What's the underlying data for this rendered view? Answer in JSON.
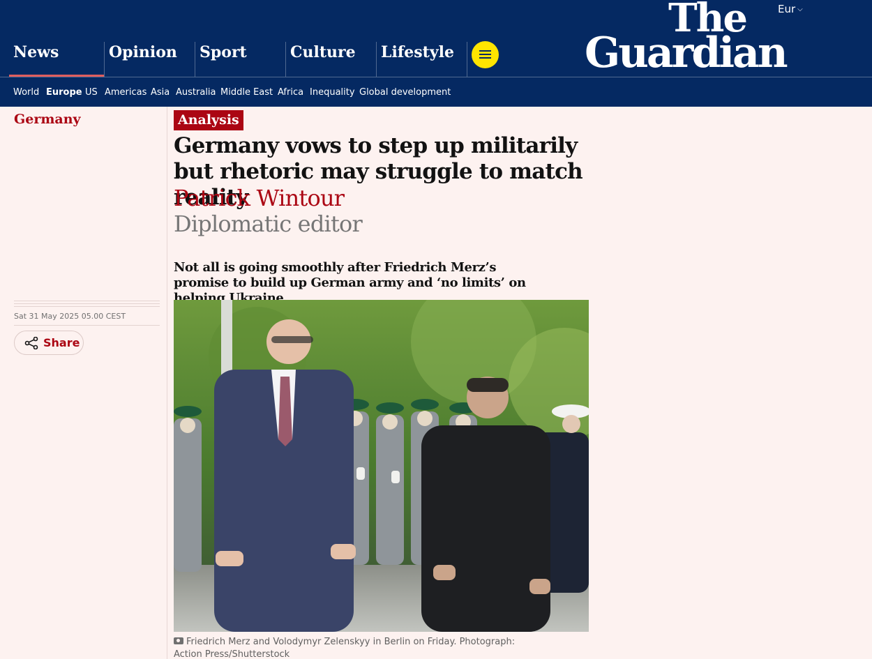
{
  "header": {
    "edition": "Eur",
    "logo_the": "The",
    "logo_guardian": "Guardian",
    "pillars": [
      "News",
      "Opinion",
      "Sport",
      "Culture",
      "Lifestyle"
    ],
    "active_pillar": "News"
  },
  "subnav": {
    "items": [
      "World",
      "Europe",
      "US",
      "Americas",
      "Asia",
      "Australia",
      "Middle East",
      "Africa",
      "Inequality",
      "Global development"
    ],
    "active": "Europe"
  },
  "sidebar": {
    "section": "Germany",
    "date": "Sat 31 May 2025 05.00 CEST",
    "share_label": "Share"
  },
  "article": {
    "kicker": "Analysis",
    "headline": "Germany vows to step up militarily but rhetoric may struggle to match reality",
    "byline": "Patrick Wintour",
    "role": "Diplomatic editor",
    "standfirst": "Not all is going smoothly after Friedrich Merz’s promise to build up German army and ‘no limits’ on helping Ukraine",
    "caption": "Friedrich Merz and Volodymyr Zelenskyy in Berlin on Friday. Photograph: Action Press/Shutterstock"
  },
  "colors": {
    "brand_blue": "#052962",
    "news_red": "#ab0613",
    "menu_yellow": "#ffe500",
    "page_bg": "#fdf2f0"
  }
}
